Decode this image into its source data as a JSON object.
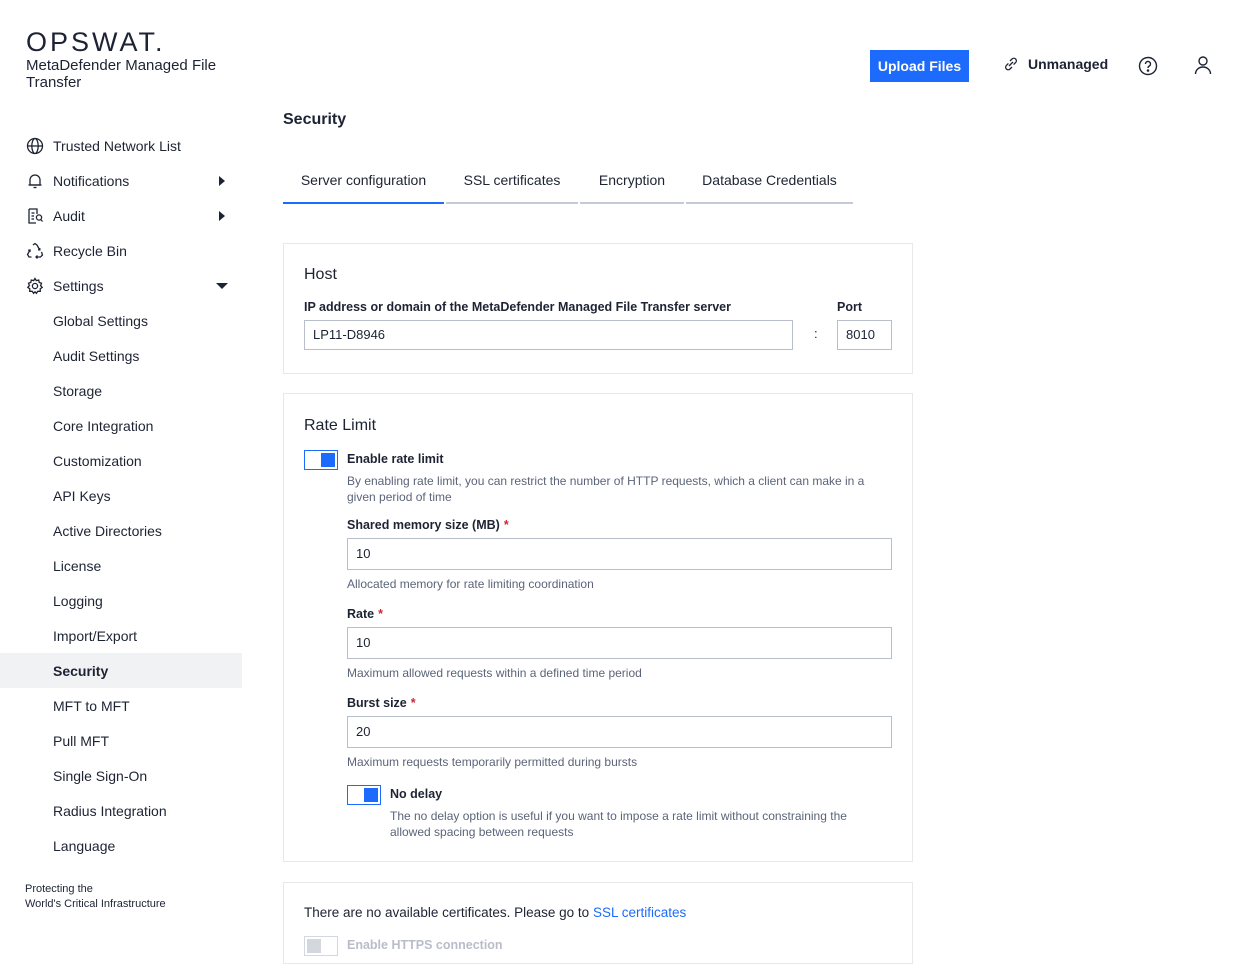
{
  "brand": {
    "logo": "OPSWAT.",
    "product": "MetaDefender Managed File Transfer"
  },
  "header": {
    "upload_label": "Upload Files",
    "unmanaged_label": "Unmanaged"
  },
  "sidebar": {
    "items": [
      {
        "label": "Trusted Network List"
      },
      {
        "label": "Notifications"
      },
      {
        "label": "Audit"
      },
      {
        "label": "Recycle Bin"
      },
      {
        "label": "Settings"
      },
      {
        "label": "Global Settings"
      },
      {
        "label": "Audit Settings"
      },
      {
        "label": "Storage"
      },
      {
        "label": "Core Integration"
      },
      {
        "label": "Customization"
      },
      {
        "label": "API Keys"
      },
      {
        "label": "Active Directories"
      },
      {
        "label": "License"
      },
      {
        "label": "Logging"
      },
      {
        "label": "Import/Export"
      },
      {
        "label": "Security"
      },
      {
        "label": "MFT to MFT"
      },
      {
        "label": "Pull MFT"
      },
      {
        "label": "Single Sign-On"
      },
      {
        "label": "Radius Integration"
      },
      {
        "label": "Language"
      }
    ],
    "footer_line1": "Protecting the",
    "footer_line2": "World's Critical Infrastructure"
  },
  "main": {
    "title": "Security",
    "tabs": [
      {
        "label": "Server configuration",
        "active": true
      },
      {
        "label": "SSL certificates"
      },
      {
        "label": "Encryption"
      },
      {
        "label": "Database Credentials"
      }
    ],
    "host": {
      "title": "Host",
      "address_label": "IP address or domain of the MetaDefender Managed File Transfer server",
      "address_value": "LP11-D8946",
      "separator": ":",
      "port_label": "Port",
      "port_value": "8010"
    },
    "rate_limit": {
      "title": "Rate Limit",
      "enable_label": "Enable rate limit",
      "enable_on": true,
      "enable_hint": "By enabling rate limit, you can restrict the number of HTTP requests, which a client can make in a given period of time",
      "memory_label": "Shared memory size (MB)",
      "memory_value": "10",
      "memory_hint": "Allocated memory for rate limiting coordination",
      "rate_label": "Rate",
      "rate_value": "10",
      "rate_hint": "Maximum allowed requests within a defined time period",
      "burst_label": "Burst size",
      "burst_value": "20",
      "burst_hint": "Maximum requests temporarily permitted during bursts",
      "required_mark": "*",
      "nodelay_label": "No delay",
      "nodelay_on": true,
      "nodelay_hint": "The no delay option is useful if you want to impose a rate limit without constraining the allowed spacing between requests"
    },
    "https": {
      "no_cert_text": "There are no available certificates. Please go to",
      "no_cert_link": "SSL certificates",
      "enable_label": "Enable HTTPS connection"
    }
  },
  "colors": {
    "accent": "#1d6bfc",
    "text": "#1d2333",
    "required": "#d1253a",
    "active_bg": "#f1f2f4"
  }
}
